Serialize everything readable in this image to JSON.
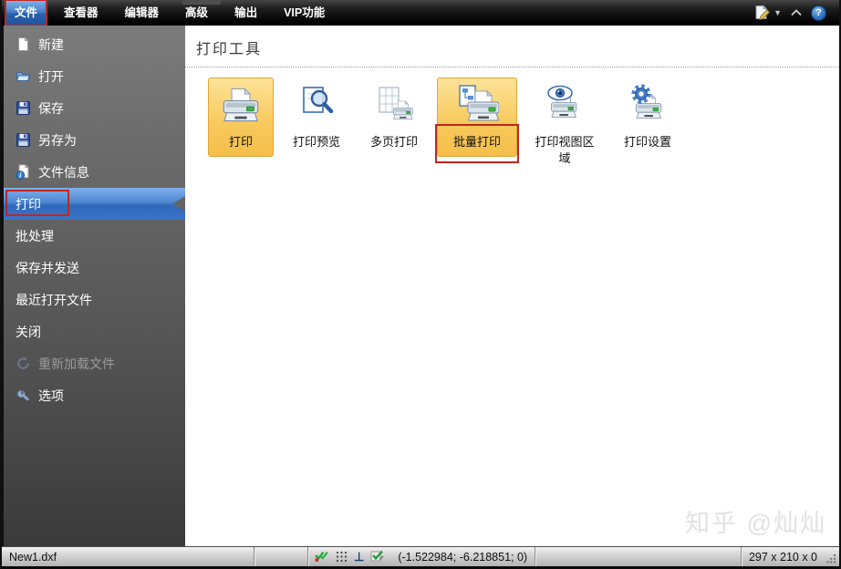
{
  "menu_bar": {
    "tabs": [
      {
        "label": "文件"
      },
      {
        "label": "查看器"
      },
      {
        "label": "编辑器"
      },
      {
        "label": "高级"
      },
      {
        "label": "输出"
      },
      {
        "label": "VIP功能"
      }
    ]
  },
  "quick_access": {
    "help_label": "?"
  },
  "sidebar": {
    "items": [
      {
        "label": "新建"
      },
      {
        "label": "打开"
      },
      {
        "label": "保存"
      },
      {
        "label": "另存为"
      },
      {
        "label": "文件信息"
      },
      {
        "label": "打印"
      },
      {
        "label": "批处理"
      },
      {
        "label": "保存并发送"
      },
      {
        "label": "最近打开文件"
      },
      {
        "label": "关闭"
      },
      {
        "label": "重新加载文件"
      },
      {
        "label": "选项"
      }
    ]
  },
  "content": {
    "title": "打印工具",
    "buttons": [
      {
        "label": "打印"
      },
      {
        "label": "打印预览"
      },
      {
        "label": "多页打印"
      },
      {
        "label": "批量打印"
      },
      {
        "label": "打印视图区域"
      },
      {
        "label": "打印设置"
      }
    ]
  },
  "status_bar": {
    "filename": "New1.dxf",
    "coordinates": "(-1.522984; -6.218851; 0)",
    "dimensions": "297 x 210 x 0",
    "perpendicular": "⊥"
  },
  "watermark": "知乎 @灿灿",
  "colors": {
    "accent_blue": "#3c74c4",
    "highlight_orange": "#f6c75f",
    "annotation_red": "#c1261d"
  }
}
